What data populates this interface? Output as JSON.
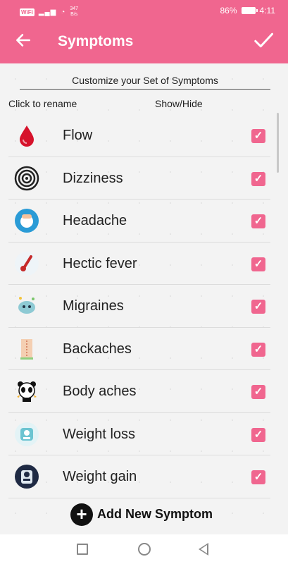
{
  "status_bar": {
    "carrier_chip": "WiFi",
    "speed": "347\nB/s",
    "battery": "86%",
    "time": "4:11"
  },
  "header": {
    "title": "Symptoms"
  },
  "colors": {
    "accent": "#f0668f"
  },
  "intro": "Customize your Set of Symptoms",
  "columns": {
    "left": "Click to rename",
    "right": "Show/Hide"
  },
  "symptoms": [
    {
      "label": "Flow",
      "icon": "blood-drop-icon",
      "checked": true
    },
    {
      "label": "Dizziness",
      "icon": "spiral-icon",
      "checked": true
    },
    {
      "label": "Headache",
      "icon": "headache-icon",
      "checked": true
    },
    {
      "label": "Hectic fever",
      "icon": "thermometer-icon",
      "checked": true
    },
    {
      "label": "Migraines",
      "icon": "brain-icon",
      "checked": true
    },
    {
      "label": "Backaches",
      "icon": "back-icon",
      "checked": true
    },
    {
      "label": "Body aches",
      "icon": "panda-icon",
      "checked": true
    },
    {
      "label": "Weight loss",
      "icon": "scale-icon",
      "checked": true
    },
    {
      "label": "Weight gain",
      "icon": "scale-dark-icon",
      "checked": true
    }
  ],
  "add_button": {
    "label": "Add New Symptom"
  }
}
